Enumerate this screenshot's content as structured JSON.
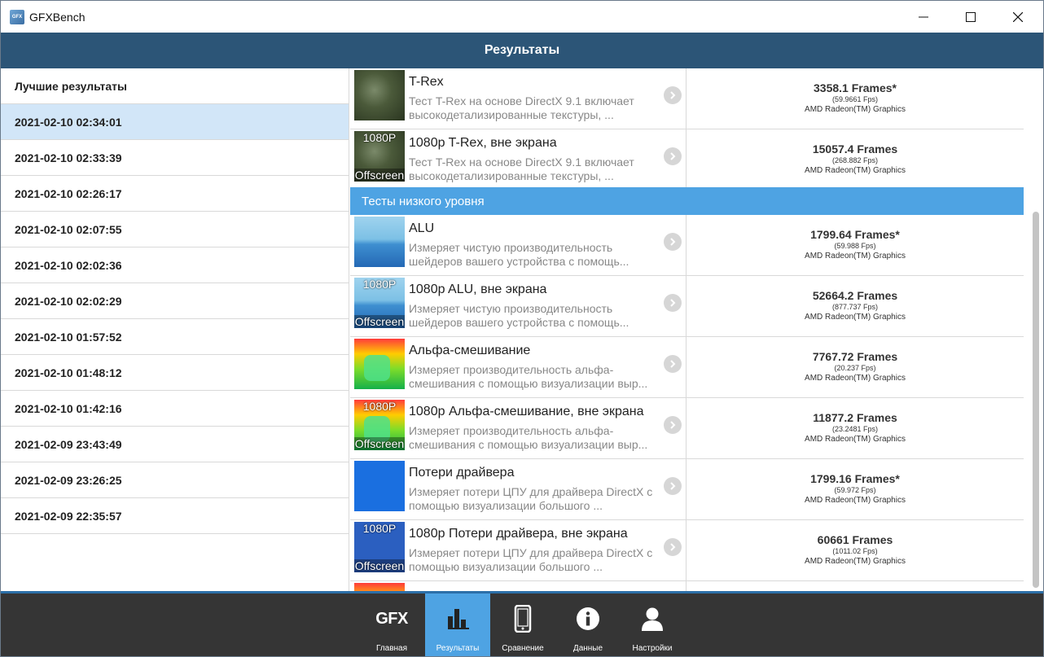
{
  "window": {
    "title": "GFXBench",
    "app_icon_text": "GFX"
  },
  "header": {
    "title": "Результаты"
  },
  "sidebar": {
    "heading": "Лучшие результаты",
    "items": [
      "2021-02-10 02:34:01",
      "2021-02-10 02:33:39",
      "2021-02-10 02:26:17",
      "2021-02-10 02:07:55",
      "2021-02-10 02:02:36",
      "2021-02-10 02:02:29",
      "2021-02-10 01:57:52",
      "2021-02-10 01:48:12",
      "2021-02-10 01:42:16",
      "2021-02-09 23:43:49",
      "2021-02-09 23:26:25",
      "2021-02-09 22:35:57"
    ]
  },
  "results": {
    "trex": {
      "name": "T-Rex",
      "desc": "Тест T-Rex на основе DirectX 9.1 включает высокодетализированные текстуры, ...",
      "frames": "3358.1 Frames*",
      "fps": "(59.9661 Fps)",
      "gpu": "AMD Radeon(TM) Graphics"
    },
    "trex_off": {
      "name": "1080p T-Rex, вне экрана",
      "desc": "Тест T-Rex на основе DirectX 9.1 включает высокодетализированные текстуры, ...",
      "frames": "15057.4 Frames",
      "fps": "(268.882 Fps)",
      "gpu": "AMD Radeon(TM) Graphics",
      "badge_top": "1080P",
      "badge_bottom": "Offscreen"
    },
    "section_low": "Тесты низкого уровня",
    "alu": {
      "name": "ALU",
      "desc": "Измеряет чистую производительность шейдеров вашего устройства с помощь...",
      "frames": "1799.64 Frames*",
      "fps": "(59.988 Fps)",
      "gpu": "AMD Radeon(TM) Graphics"
    },
    "alu_off": {
      "name": "1080p ALU, вне экрана",
      "desc": "Измеряет чистую производительность шейдеров вашего устройства с помощь...",
      "frames": "52664.2 Frames",
      "fps": "(877.737 Fps)",
      "gpu": "AMD Radeon(TM) Graphics",
      "badge_top": "1080P",
      "badge_bottom": "Offscreen"
    },
    "alpha": {
      "name": "Альфа-смешивание",
      "desc": "Измеряет производительность альфа-смешивания с помощью визуализации выр...",
      "frames": "7767.72 Frames",
      "fps": "(20.237 Fps)",
      "gpu": "AMD Radeon(TM) Graphics"
    },
    "alpha_off": {
      "name": "1080p Альфа-смешивание, вне экрана",
      "desc": "Измеряет производительность альфа-смешивания с помощью визуализации выр...",
      "frames": "11877.2 Frames",
      "fps": "(23.2481 Fps)",
      "gpu": "AMD Radeon(TM) Graphics",
      "badge_top": "1080P",
      "badge_bottom": "Offscreen"
    },
    "driver": {
      "name": "Потери драйвера",
      "desc": "Измеряет потери ЦПУ для драйвера DirectX с помощью визуализации большого ...",
      "frames": "1799.16 Frames*",
      "fps": "(59.972 Fps)",
      "gpu": "AMD Radeon(TM) Graphics"
    },
    "driver_off": {
      "name": "1080p Потери драйвера, вне экрана",
      "desc": "Измеряет потери ЦПУ для драйвера DirectX с помощью визуализации большого ...",
      "frames": "60661 Frames",
      "fps": "(1011.02 Fps)",
      "gpu": "AMD Radeon(TM) Graphics",
      "badge_top": "1080P",
      "badge_bottom": "Offscreen"
    }
  },
  "nav": {
    "home_logo": "GFX",
    "home": "Главная",
    "results": "Результаты",
    "compare": "Сравнение",
    "data": "Данные",
    "settings": "Настройки"
  },
  "colors": {
    "header": "#2c5577",
    "accent": "#4ea3e3",
    "bottombar": "#353535",
    "selected_row": "#d2e6f8"
  }
}
